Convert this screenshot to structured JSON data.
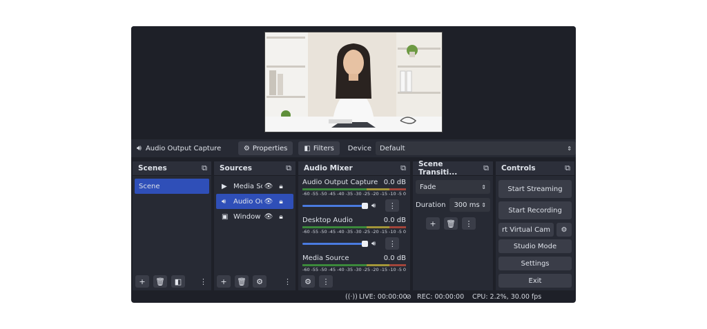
{
  "source_bar": {
    "selected_source": "Audio Output Capture",
    "properties_label": "Properties",
    "filters_label": "Filters",
    "device_label": "Device",
    "device_value": "Default"
  },
  "scenes": {
    "title": "Scenes",
    "items": [
      {
        "label": "Scene"
      }
    ]
  },
  "sources": {
    "title": "Sources",
    "items": [
      {
        "label": "Media So",
        "icon": "play-icon"
      },
      {
        "label": "Audio Ou",
        "icon": "speaker-icon"
      },
      {
        "label": "Window C",
        "icon": "window-icon"
      }
    ]
  },
  "mixer": {
    "title": "Audio Mixer",
    "ticks": [
      "-60",
      "-55",
      "-50",
      "-45",
      "-40",
      "-35",
      "-30",
      "-25",
      "-20",
      "-15",
      "-10",
      "-5",
      "0"
    ],
    "channels": [
      {
        "name": "Audio Output Capture",
        "level": "0.0 dB"
      },
      {
        "name": "Desktop Audio",
        "level": "0.0 dB"
      },
      {
        "name": "Media Source",
        "level": "0.0 dB"
      }
    ]
  },
  "transitions": {
    "title": "Scene Transiti...",
    "selected": "Fade",
    "duration_label": "Duration",
    "duration_value": "300 ms"
  },
  "controls": {
    "title": "Controls",
    "start_streaming": "Start Streaming",
    "start_recording": "Start Recording",
    "virtual_cam": "rt Virtual Cam",
    "studio_mode": "Studio Mode",
    "settings": "Settings",
    "exit": "Exit"
  },
  "status": {
    "live": "LIVE: 00:00:00",
    "rec": "REC: 00:00:00",
    "cpu": "CPU: 2.2%, 30.00 fps"
  },
  "colors": {
    "window_bg": "#1e2028",
    "dock_bg": "#272a34",
    "button_bg": "#3a3d48",
    "selection": "#2f4fb8",
    "slider": "#4a7be0"
  }
}
